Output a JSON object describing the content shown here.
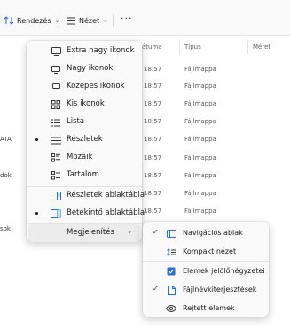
{
  "toolbar": {
    "sort_label": "Rendezés",
    "view_label": "Nézet",
    "more_label": "···"
  },
  "columns": {
    "date": "átuma",
    "type": "Típus",
    "size": "Méret"
  },
  "rows": [
    {
      "date": "18:57",
      "type": "Fájlmappa",
      "left": ""
    },
    {
      "date": "18:57",
      "type": "Fájlmappa",
      "left": ""
    },
    {
      "date": "18:57",
      "type": "Fájlmappa",
      "left": ""
    },
    {
      "date": "18:57",
      "type": "Fájlmappa",
      "left": ""
    },
    {
      "date": "18:57",
      "type": "Fájlmappa",
      "left": "ATA"
    },
    {
      "date": "18:57",
      "type": "Fájlmappa",
      "left": ""
    },
    {
      "date": "18:57",
      "type": "Fájlmappa",
      "left": "dok"
    },
    {
      "date": "18:57",
      "type": "Fájlmappa",
      "left": ""
    },
    {
      "date": "18:57",
      "type": "Fájlmappa",
      "left": ""
    },
    {
      "date": "18:57",
      "type": "Fájlmappa",
      "left": "sok"
    }
  ],
  "view_menu": {
    "items": [
      {
        "label": "Extra nagy ikonok",
        "icon": "monitor-icon",
        "selected": false
      },
      {
        "label": "Nagy ikonok",
        "icon": "monitor-icon",
        "selected": false
      },
      {
        "label": "Közepes ikonok",
        "icon": "monitor-icon",
        "selected": false
      },
      {
        "label": "Kis ikonok",
        "icon": "grid-icon",
        "selected": false
      },
      {
        "label": "Lista",
        "icon": "list-icon",
        "selected": false
      },
      {
        "label": "Részletek",
        "icon": "details-icon",
        "selected": true
      },
      {
        "label": "Mozaik",
        "icon": "tiles-icon",
        "selected": false
      },
      {
        "label": "Tartalom",
        "icon": "content-icon",
        "selected": false
      },
      {
        "label": "Részletek ablaktábla",
        "icon": "details-pane-icon",
        "selected": false
      },
      {
        "label": "Betekintő ablaktábla",
        "icon": "preview-pane-icon",
        "selected": true
      },
      {
        "label": "Megjelenítés",
        "icon": "",
        "selected": false
      }
    ]
  },
  "show_submenu": {
    "items": [
      {
        "label": "Navigációs ablak",
        "icon": "navigation-pane-icon",
        "checked": true
      },
      {
        "label": "Kompakt nézet",
        "icon": "compact-view-icon",
        "checked": false
      },
      {
        "label": "Elemek jelölőnégyzetei",
        "icon": "checkbox-icon",
        "checked": false
      },
      {
        "label": "Fájlnévkiterjesztések",
        "icon": "file-icon",
        "checked": true
      },
      {
        "label": "Rejtett elemek",
        "icon": "eye-icon",
        "checked": false
      }
    ]
  },
  "colors": {
    "accent": "#2b6fce",
    "menu_bg": "#f9f9f9"
  }
}
